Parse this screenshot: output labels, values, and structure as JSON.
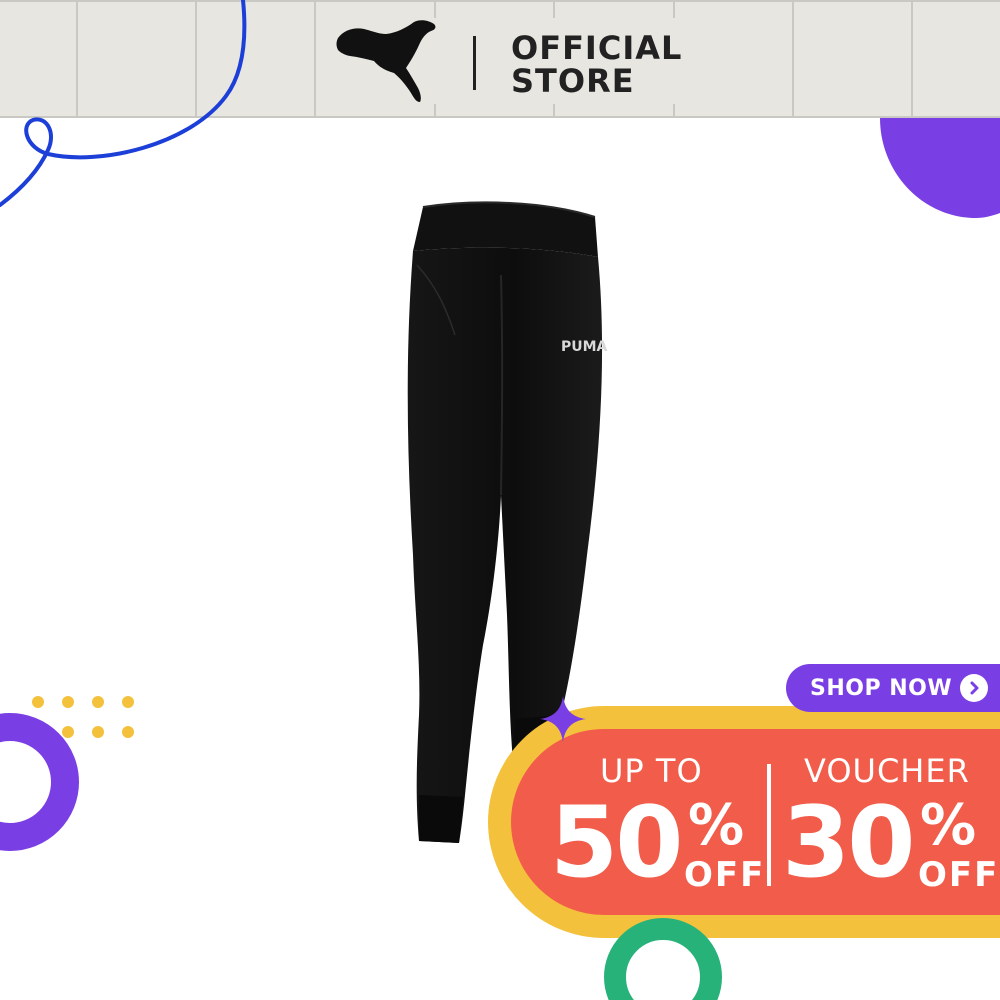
{
  "header": {
    "brand_icon": "puma-leaping-cat-logo",
    "store_line1": "OFFICIAL",
    "store_line2": "STORE"
  },
  "product": {
    "type": "black-jogger-pants",
    "waist_logo": "PUMA"
  },
  "promo": {
    "cta_label": "SHOP NOW",
    "cta_icon": "chevron-right-circle-icon",
    "left_caption": "UP TO",
    "left_value": "50",
    "left_percent": "%",
    "left_off": "OFF",
    "right_caption": "VOUCHER",
    "right_value": "30",
    "right_percent": "%",
    "right_off": "OFF"
  },
  "colors": {
    "header_bg": "#e7e6e1",
    "accent_purple": "#7a3fe4",
    "banner_yellow": "#f4c13c",
    "banner_red": "#f25c4a",
    "ring_green": "#27b27a",
    "dots_yellow": "#f4c13c",
    "curve_blue": "#1c3fd8"
  }
}
